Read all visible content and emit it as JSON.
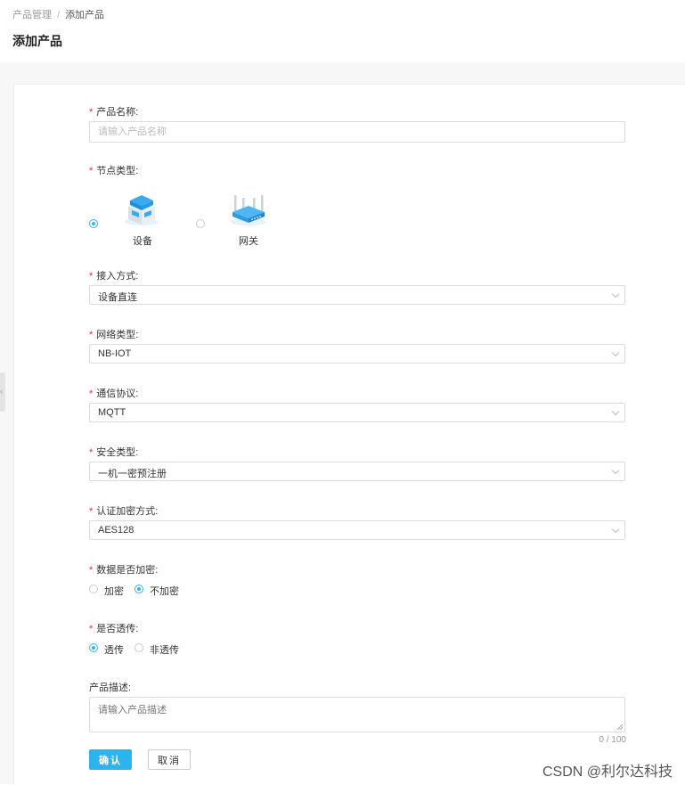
{
  "breadcrumb": {
    "root": "产品管理",
    "sep": "/",
    "current": "添加产品"
  },
  "page_title": "添加产品",
  "form": {
    "name": {
      "label": "产品名称:",
      "placeholder": "请输入产品名称"
    },
    "node_type": {
      "label": "节点类型:",
      "options": [
        {
          "label": "设备",
          "icon": "device-server-icon",
          "selected": true
        },
        {
          "label": "网关",
          "icon": "gateway-router-icon",
          "selected": false
        }
      ]
    },
    "access": {
      "label": "接入方式:",
      "value": "设备直连"
    },
    "network": {
      "label": "网络类型:",
      "value": "NB-IOT"
    },
    "protocol": {
      "label": "通信协议:",
      "value": "MQTT"
    },
    "security": {
      "label": "安全类型:",
      "value": "一机一密预注册"
    },
    "auth": {
      "label": "认证加密方式:",
      "value": "AES128"
    },
    "encrypt": {
      "label": "数据是否加密:",
      "options": [
        {
          "label": "加密",
          "selected": false
        },
        {
          "label": "不加密",
          "selected": true
        }
      ]
    },
    "passthrough": {
      "label": "是否透传:",
      "options": [
        {
          "label": "透传",
          "selected": true
        },
        {
          "label": "非透传",
          "selected": false
        }
      ]
    },
    "description": {
      "label": "产品描述:",
      "placeholder": "请输入产品描述",
      "counter": "0 / 100"
    }
  },
  "buttons": {
    "confirm": "确认",
    "cancel": "取消"
  },
  "watermark": "CSDN @利尔达科技",
  "colors": {
    "accent": "#2fb3ed",
    "required": "#f5222d"
  }
}
